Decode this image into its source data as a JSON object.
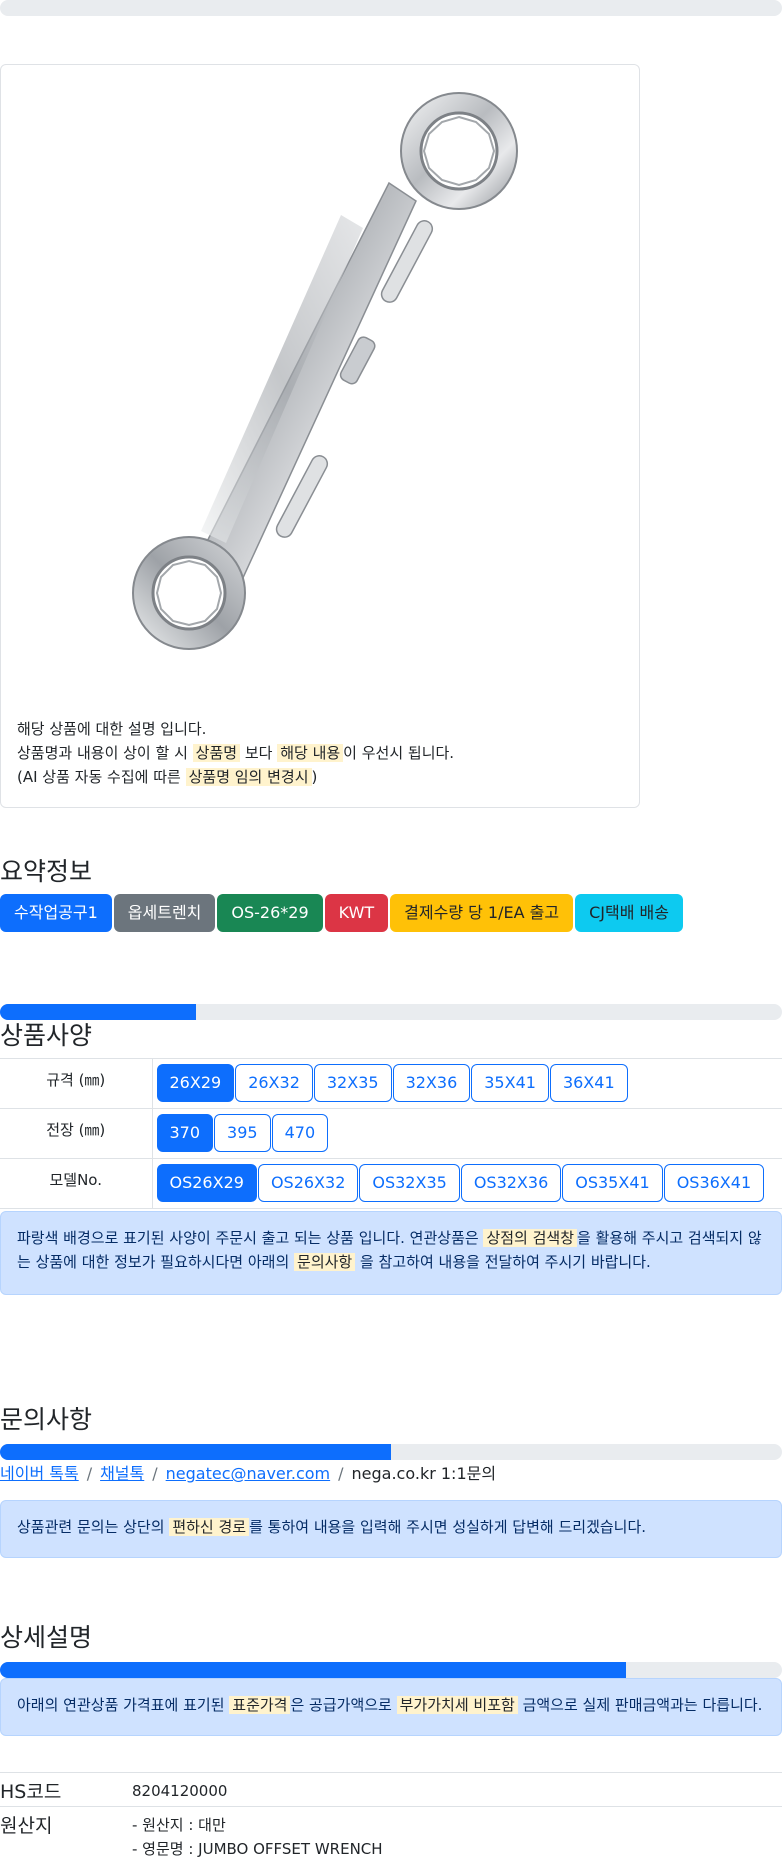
{
  "card": {
    "desc_line1": "해당 상품에 대한 설명 입니다.",
    "desc_line2_a": "상품명과 내용이 상이 할 시 ",
    "desc_line2_mark1": "상품명",
    "desc_line2_b": " 보다 ",
    "desc_line2_mark2": "해당 내용",
    "desc_line2_c": "이 우선시 됩니다.",
    "desc_line3_a": "(AI 상품 자동 수집에 따른 ",
    "desc_line3_mark": "상품명 임의 변경시",
    "desc_line3_b": ")"
  },
  "summary": {
    "title": "요약정보",
    "badges": [
      "수작업공구1",
      "옵세트렌치",
      "OS-26*29",
      "KWT",
      "결제수량 당 1/EA 출고",
      "CJ택배 배송"
    ]
  },
  "specs": {
    "title": "상품사양",
    "progress_percent": 25,
    "rows": [
      {
        "label": "규격 (㎜)",
        "options": [
          "26X29",
          "26X32",
          "32X35",
          "32X36",
          "35X41",
          "36X41"
        ],
        "selected": "26X29"
      },
      {
        "label": "전장 (㎜)",
        "options": [
          "370",
          "395",
          "470"
        ],
        "selected": "370"
      },
      {
        "label": "모델No.",
        "options": [
          "OS26X29",
          "OS26X32",
          "OS32X35",
          "OS32X36",
          "OS35X41",
          "OS36X41"
        ],
        "selected": "OS26X29"
      }
    ],
    "notice_a": "파랑색 배경으로 표기된 사양이 주문시 출고 되는 상품 입니다. 연관상품은 ",
    "notice_mark1": "상점의 검색창",
    "notice_b": "을 활용해 주시고 검색되지 않는 상품에 대한 정보가 필요하시다면 아래의 ",
    "notice_mark2": "문의사항",
    "notice_c": " 을 참고하여 내용을 전달하여 주시기 바랍니다."
  },
  "inquiry": {
    "title": "문의사항",
    "progress_percent": 50,
    "links": [
      "네이버 톡톡",
      "채널톡",
      "negatec@naver.com"
    ],
    "plain": "nega.co.kr 1:1문의",
    "notice_a": "상품관련 문의는 상단의 ",
    "notice_mark": "편하신 경로",
    "notice_b": "를 통하여 내용을 입력해 주시면 성실하게 답변해 드리겠습니다."
  },
  "detail": {
    "title": "상세설명",
    "progress_percent": 80,
    "notice_a": "아래의 연관상품 가격표에 표기된 ",
    "notice_mark1": "표준가격",
    "notice_b": "은 공급가액으로 ",
    "notice_mark2": "부가가치세 비포함",
    "notice_c": " 금액으로 실제 판매금액과는 다릅니다."
  },
  "info": {
    "hs_label": "HS코드",
    "hs_value": "8204120000",
    "origin_label": "원산지",
    "origin_line1": "- 원산지 : 대만",
    "origin_line2": "- 영문명 : JUMBO OFFSET WRENCH"
  },
  "colors": {
    "primary": "#0d6efd",
    "secondary": "#6c757d",
    "success": "#198754",
    "danger": "#dc3545",
    "warning": "#ffc107",
    "info": "#0dcaf0"
  }
}
